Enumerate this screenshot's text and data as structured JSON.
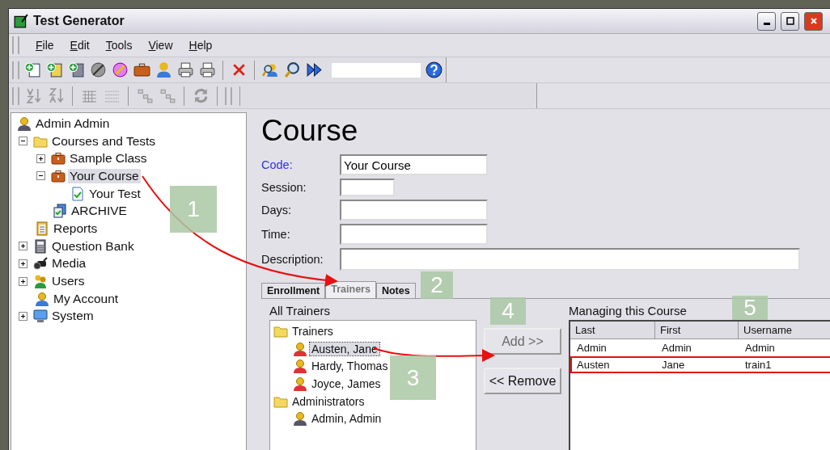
{
  "window": {
    "title": "Test Generator"
  },
  "menu": [
    "File",
    "Edit",
    "Tools",
    "View",
    "Help"
  ],
  "tree": [
    {
      "label": "Admin Admin",
      "kind": "admin",
      "selected": false,
      "children": [
        {
          "label": "Courses and Tests",
          "kind": "folder",
          "selected": false,
          "expanded": true,
          "children": [
            {
              "label": "Sample Class",
              "kind": "briefcase",
              "selected": false,
              "expanded": false
            },
            {
              "label": "Your Course",
              "kind": "briefcase",
              "selected": true,
              "expanded": true,
              "children": [
                {
                  "label": "Your Test",
                  "kind": "test",
                  "selected": false
                }
              ]
            },
            {
              "label": "ARCHIVE",
              "kind": "archive",
              "selected": false
            }
          ]
        },
        {
          "label": "Reports",
          "kind": "report",
          "selected": false
        },
        {
          "label": "Question Bank",
          "kind": "bank",
          "selected": false,
          "expanded": false
        },
        {
          "label": "Media",
          "kind": "camera",
          "selected": false,
          "expanded": false
        },
        {
          "label": "Users",
          "kind": "users",
          "selected": false,
          "expanded": false
        },
        {
          "label": "My Account",
          "kind": "person",
          "selected": false
        },
        {
          "label": "System",
          "kind": "monitor",
          "selected": false,
          "expanded": false
        }
      ]
    }
  ],
  "form": {
    "title": "Course",
    "fields": [
      {
        "label": "Code:",
        "value": "Your Course",
        "kind": "medium",
        "active": true
      },
      {
        "label": "Session:",
        "kind": "short",
        "active": false
      },
      {
        "label": "Days:",
        "kind": "medium",
        "active": false
      },
      {
        "label": "Time:",
        "kind": "medium",
        "active": false
      },
      {
        "label": "Description:",
        "kind": "long",
        "active": false
      }
    ]
  },
  "tabs": [
    {
      "label": "Enrollment",
      "selected": false
    },
    {
      "label": "Trainers",
      "selected": true
    },
    {
      "label": "Notes",
      "selected": false
    }
  ],
  "all_trainers": {
    "title": "All Trainers",
    "groups": [
      {
        "label": "Trainers",
        "children": [
          {
            "label": "Austen, Jane",
            "kind": "trainer",
            "selected": true
          },
          {
            "label": "Hardy, Thomas",
            "kind": "trainer",
            "selected": false
          },
          {
            "label": "Joyce, James",
            "kind": "trainer",
            "selected": false
          }
        ]
      },
      {
        "label": "Administrators",
        "children": [
          {
            "label": "Admin, Admin",
            "kind": "admin",
            "selected": false
          }
        ]
      }
    ]
  },
  "buttons": [
    {
      "label": "Add >>",
      "disabled": true
    },
    {
      "label": "<< Remove",
      "disabled": false
    }
  ],
  "managing": {
    "title": "Managing this Course",
    "columns": [
      "Last",
      "First",
      "Username"
    ],
    "rows": [
      {
        "cells": [
          "Admin",
          "Admin",
          "Admin"
        ],
        "highlighted": false
      },
      {
        "cells": [
          "Austen",
          "Jane",
          "train1"
        ],
        "highlighted": true
      }
    ]
  },
  "callouts": [
    "1",
    "2",
    "3",
    "4",
    "5"
  ]
}
